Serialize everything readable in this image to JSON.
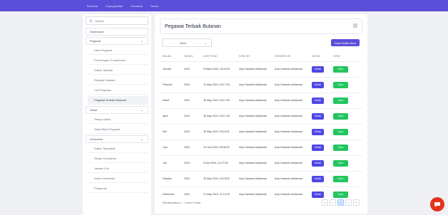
{
  "topnav": [
    "Beranda",
    "Kepegawaian",
    "Kenaikan",
    "Absen"
  ],
  "sidebar": {
    "search_placeholder": "Search",
    "items": [
      {
        "label": "Dashboard",
        "type": "item"
      },
      {
        "label": "Pegawai",
        "type": "group"
      },
      {
        "label": "Data Pegawai",
        "type": "sub"
      },
      {
        "label": "Perhitungan Kompetensi",
        "type": "sub"
      },
      {
        "label": "Daftar Jabatan",
        "type": "sub"
      },
      {
        "label": "Riwayat Jabatan",
        "type": "sub"
      },
      {
        "label": "Cuti Pegawai",
        "type": "sub"
      },
      {
        "label": "Pegawai Terbaik Bulanan",
        "type": "sub",
        "active": true
      },
      {
        "label": "Diklat",
        "type": "group"
      },
      {
        "label": "Rekap Diklat",
        "type": "sub"
      },
      {
        "label": "Data Diklat Pegawai",
        "type": "sub"
      },
      {
        "label": "Kehadiran",
        "type": "group"
      },
      {
        "label": "Daftar Terlambat",
        "type": "sub"
      },
      {
        "label": "Rekap Kehadiran",
        "type": "sub"
      },
      {
        "label": "Jadwal Cuti",
        "type": "sub"
      },
      {
        "label": "Klaim Kehadiran",
        "type": "sub"
      },
      {
        "label": "Pelaporan",
        "type": "sub"
      }
    ]
  },
  "main": {
    "title": "Pegawai Terbaik Bulanan",
    "year": "2024",
    "add_button": "Buat Daftar Baru",
    "columns": [
      "BULAN",
      "TAHUN",
      "LAST SYNC",
      "SYNC BY",
      "CREATED BY",
      "DETAIL",
      "SYNC"
    ],
    "detail_label": "Detail",
    "sync_label": "Sync",
    "rows": [
      {
        "bulan": "Januari",
        "tahun": "2024",
        "last_sync": "5 Maret 2024, 15:23:40",
        "sync_by": "Aryo Harianto Ardiansah",
        "created_by": "Aryo Harianto Ardiansah"
      },
      {
        "bulan": "Februari",
        "tahun": "2024",
        "last_sync": "10 May 2024, 15:17:04",
        "sync_by": "Aryo Harianto Ardiansah",
        "created_by": "Aryo Harianto Ardiansah"
      },
      {
        "bulan": "Maret",
        "tahun": "2024",
        "last_sync": "30 May 2024, 15:17:00",
        "sync_by": "Aryo Harianto Ardiansah",
        "created_by": "Aryo Harianto Ardiansah"
      },
      {
        "bulan": "April",
        "tahun": "2024",
        "last_sync": "30 May 2024, 15:17:08",
        "sync_by": "Aryo Harianto Ardiansah",
        "created_by": "Aryo Harianto Ardiansah"
      },
      {
        "bulan": "Mei",
        "tahun": "2024",
        "last_sync": "30 May 2024, 15:18:01",
        "sync_by": "Aryo Harianto Ardiansah",
        "created_by": "Aryo Harianto Ardiansah"
      },
      {
        "bulan": "Juni",
        "tahun": "2024",
        "last_sync": "19 Juni 2024, 09:08:24",
        "sync_by": "Aryo Harianto Ardiansah",
        "created_by": "Aryo Harianto Ardiansah"
      },
      {
        "bulan": "Juli",
        "tahun": "2024",
        "last_sync": "6 Nov 2024, 21:27:08",
        "sync_by": "Aryo Harianto Ardiansah",
        "created_by": "Aryo Harianto Ardiansah"
      },
      {
        "bulan": "Oktober",
        "tahun": "2024",
        "last_sync": "30 May 2024, 15:18:02",
        "sync_by": "Aryo Harianto Ardiansah",
        "created_by": "Aryo Harianto Ardiansah"
      },
      {
        "bulan": "Desember",
        "tahun": "2024",
        "last_sync": "21 May 2024, 21:19:40",
        "sync_by": "Aryo Harianto Ardiansah",
        "created_by": "Aryo Harianto Ardiansah"
      }
    ],
    "footer_info": "Menampilkan 1 - 9 dari 9 data",
    "pager": [
      "«",
      "‹",
      "1",
      "›",
      "»"
    ]
  },
  "colors": {
    "brand": "#5b4ed8",
    "detail": "#4f46e5",
    "sync": "#22c55e",
    "fab": "#e4321b"
  }
}
